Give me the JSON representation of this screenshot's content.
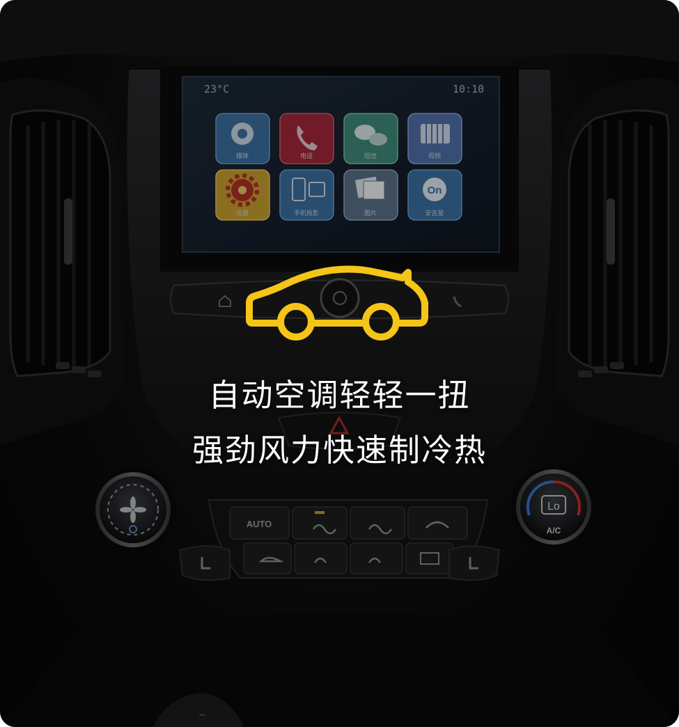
{
  "screen": {
    "temperature": "23°C",
    "time": "10:10",
    "apps": [
      {
        "label": "媒体",
        "icon": "speaker-icon",
        "color": "#3a6fa0"
      },
      {
        "label": "电话",
        "icon": "phone-icon",
        "color": "#a2283a"
      },
      {
        "label": "短信",
        "icon": "message-icon",
        "color": "#3f8a7a"
      },
      {
        "label": "视频",
        "icon": "video-icon",
        "color": "#4f6fa8"
      },
      {
        "label": "设置",
        "icon": "gear-icon",
        "color": "#c8a030"
      },
      {
        "label": "手机投影",
        "icon": "phone-projection-icon",
        "color": "#3a6fa0"
      },
      {
        "label": "图片",
        "icon": "photo-icon",
        "color": "#5a7088"
      },
      {
        "label": "安吉星",
        "icon": "onstar-icon",
        "color": "#3a6fa0"
      }
    ]
  },
  "controls": {
    "auto_label": "AUTO",
    "lo_label": "Lo",
    "ac_label": "A/C"
  },
  "brand": {
    "logo_icon": "car-outline-icon",
    "logo_color": "#f5c518"
  },
  "headline": {
    "line1": "自动空调轻轻一扭",
    "line2": "强劲风力快速制冷热"
  }
}
